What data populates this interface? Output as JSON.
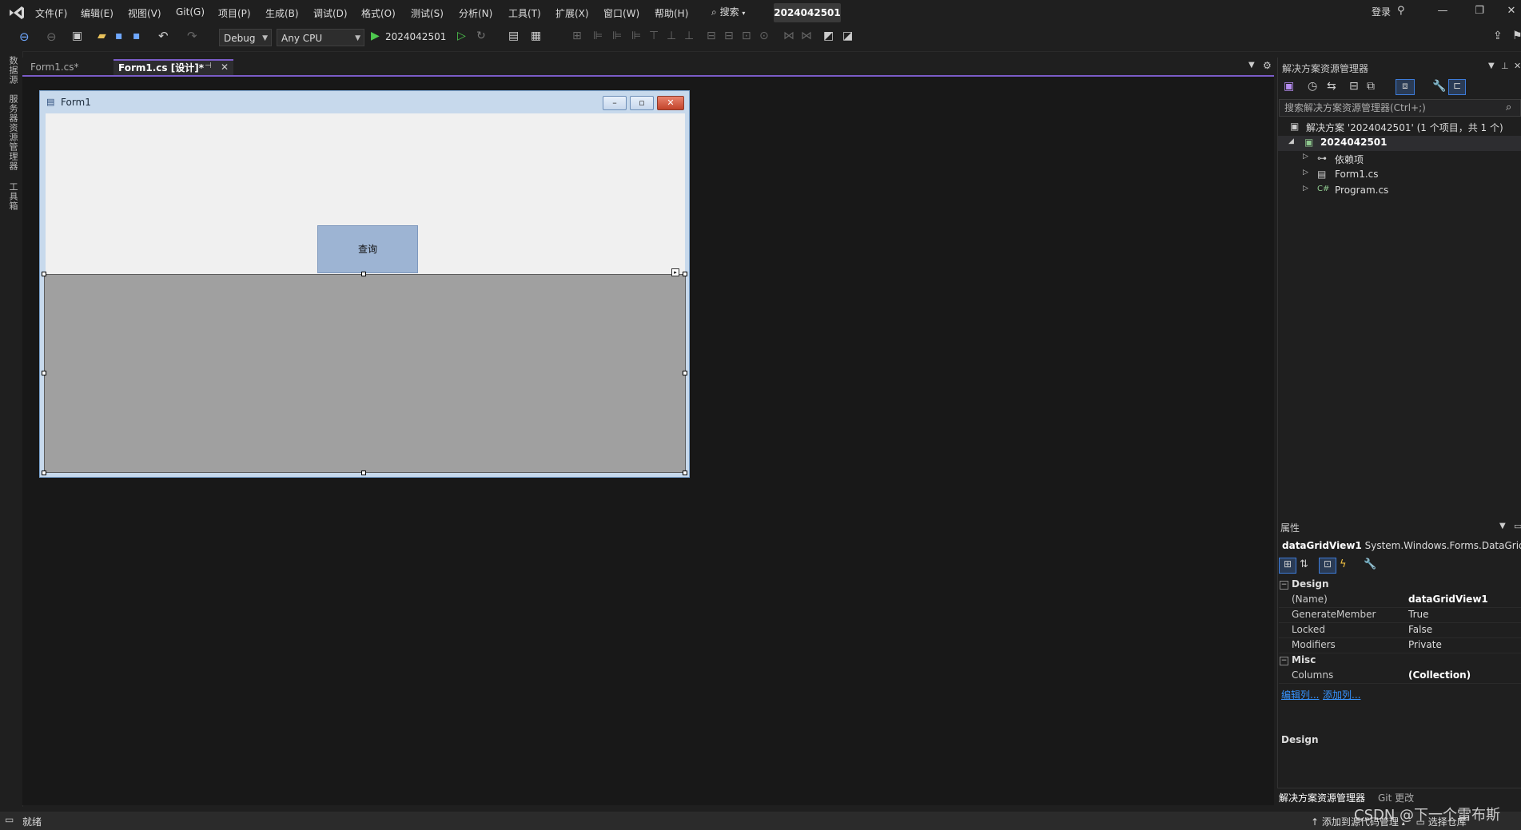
{
  "menu": {
    "items": [
      "文件(F)",
      "编辑(E)",
      "视图(V)",
      "Git(G)",
      "项目(P)",
      "生成(B)",
      "调试(D)",
      "格式(O)",
      "测试(S)",
      "分析(N)",
      "工具(T)",
      "扩展(X)",
      "窗口(W)",
      "帮助(H)"
    ],
    "search_label": "搜索",
    "solution_name": "2024042501",
    "login": "登录"
  },
  "toolbar": {
    "config": "Debug",
    "platform": "Any CPU",
    "run_target": "2024042501"
  },
  "left_strip": {
    "tabs": [
      "数据源",
      "服务器资源管理器",
      "工具箱"
    ]
  },
  "doc_tabs": [
    {
      "label": "Form1.cs*"
    },
    {
      "label": "Form1.cs [设计]*"
    }
  ],
  "form": {
    "title": "Form1",
    "button_label": "查询"
  },
  "solution_explorer": {
    "title": "解决方案资源管理器",
    "search_placeholder": "搜索解决方案资源管理器(Ctrl+;)",
    "solution_row": "解决方案 '2024042501' (1 个项目，共 1 个)",
    "project": "2024042501",
    "children": [
      "依赖项",
      "Form1.cs",
      "Program.cs"
    ]
  },
  "properties": {
    "title": "属性",
    "object_name": "dataGridView1",
    "object_type": "System.Windows.Forms.DataGridVi",
    "categories": {
      "design": "Design",
      "misc": "Misc"
    },
    "rows": [
      {
        "key": "(Name)",
        "value": "dataGridView1"
      },
      {
        "key": "GenerateMember",
        "value": "True"
      },
      {
        "key": "Locked",
        "value": "False"
      },
      {
        "key": "Modifiers",
        "value": "Private"
      },
      {
        "key": "Columns",
        "value": "(Collection)"
      }
    ],
    "links": [
      "编辑列...",
      "添加列..."
    ],
    "description_title": "Design"
  },
  "panel_tabs": [
    "解决方案资源管理器",
    "Git 更改"
  ],
  "status": {
    "left": "就绪",
    "right": "添加到源代码管理",
    "right2": "选择仓库"
  },
  "watermark": "CSDN @下一个雷布斯"
}
